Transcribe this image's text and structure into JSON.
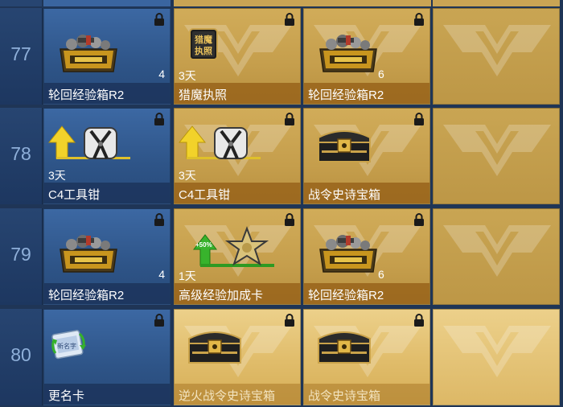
{
  "colors": {
    "free_cell": "#34609a",
    "vip_cell": "#c9a454",
    "vip_cell_highlight": "#e6c676",
    "level_column": "#23406b",
    "level_text": "#8fb0da"
  },
  "rows": [
    {
      "level": "77",
      "cells": [
        {
          "name": "轮回经验箱R2",
          "count": "4",
          "duration": "",
          "icon": "supply-crate-icon",
          "type": "free",
          "locked": true
        },
        {
          "name": "猎魔执照",
          "count": "",
          "duration": "3天",
          "icon": "hunter-license-icon",
          "type": "vip",
          "locked": true
        },
        {
          "name": "轮回经验箱R2",
          "count": "6",
          "duration": "",
          "icon": "supply-crate-icon",
          "type": "vip",
          "locked": true
        },
        {
          "name": "",
          "type": "empty"
        }
      ]
    },
    {
      "level": "78",
      "cells": [
        {
          "name": "C4工具钳",
          "count": "",
          "duration": "3天",
          "icon": "c4-pliers-icon",
          "type": "free",
          "locked": true
        },
        {
          "name": "C4工具钳",
          "count": "",
          "duration": "3天",
          "icon": "c4-pliers-icon",
          "type": "vip",
          "locked": true
        },
        {
          "name": "战令史诗宝箱",
          "count": "",
          "duration": "",
          "icon": "epic-chest-icon",
          "type": "vip",
          "locked": true
        },
        {
          "name": "",
          "type": "empty"
        }
      ]
    },
    {
      "level": "79",
      "cells": [
        {
          "name": "轮回经验箱R2",
          "count": "4",
          "duration": "",
          "icon": "supply-crate-icon",
          "type": "free",
          "locked": true
        },
        {
          "name": "高级经验加成卡",
          "count": "",
          "duration": "1天",
          "icon": "exp-boost-card-icon",
          "badge": "+50%",
          "type": "vip",
          "locked": true
        },
        {
          "name": "轮回经验箱R2",
          "count": "6",
          "duration": "",
          "icon": "supply-crate-icon",
          "type": "vip",
          "locked": true
        },
        {
          "name": "",
          "type": "empty"
        }
      ]
    },
    {
      "level": "80",
      "cells": [
        {
          "name": "更名卡",
          "count": "",
          "duration": "",
          "icon": "rename-card-icon",
          "type": "free",
          "locked": true
        },
        {
          "name": "逆火战令史诗宝箱",
          "count": "",
          "duration": "",
          "icon": "epic-chest-icon",
          "type": "vip-gold",
          "locked": true
        },
        {
          "name": "战令史诗宝箱",
          "count": "",
          "duration": "",
          "icon": "epic-chest-icon",
          "type": "vip-gold",
          "locked": true
        },
        {
          "name": "",
          "type": "empty-gold"
        }
      ]
    }
  ],
  "license_text": {
    "line1": "猎魔",
    "line2": "执照"
  },
  "rename_text": "新名字"
}
